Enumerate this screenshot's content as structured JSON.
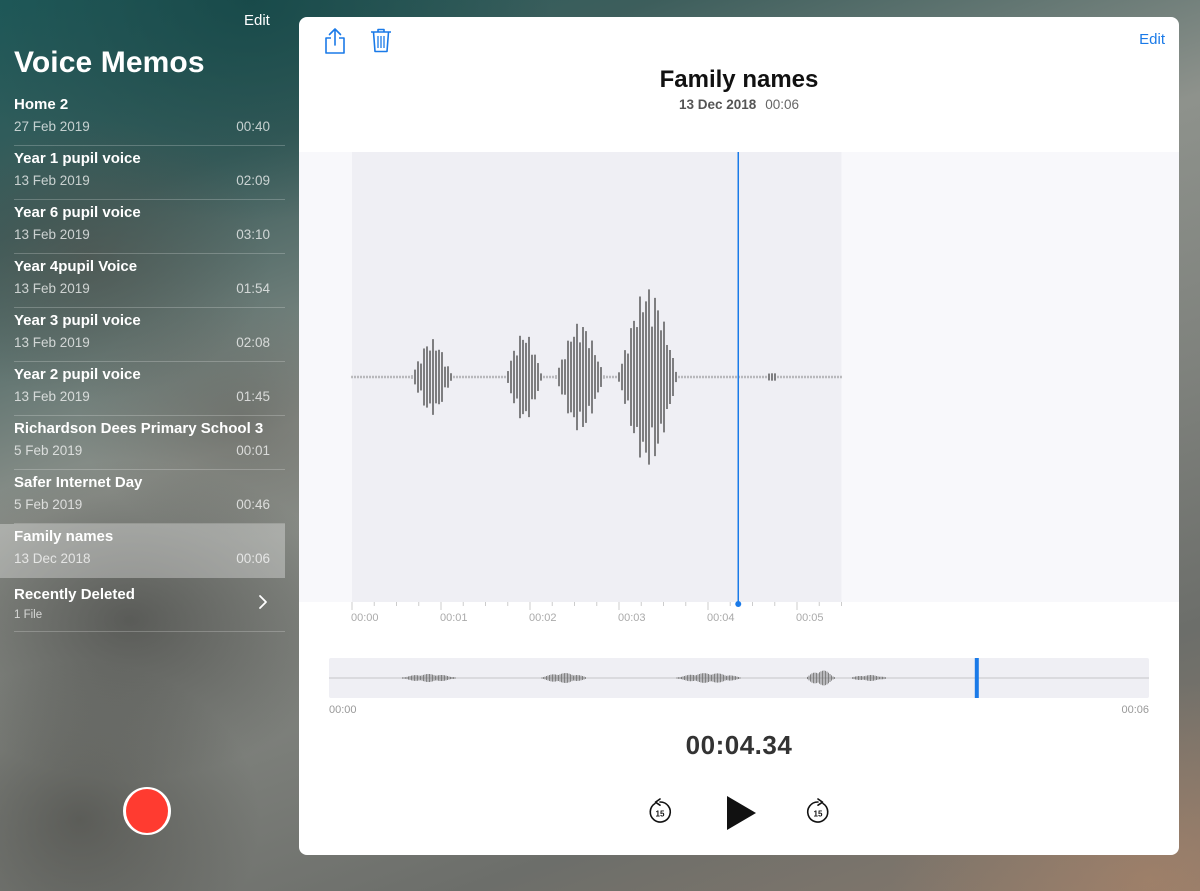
{
  "sidebar": {
    "edit_label": "Edit",
    "title": "Voice Memos",
    "memos": [
      {
        "name": "Home 2",
        "date": "27 Feb 2019",
        "duration": "00:40",
        "selected": false
      },
      {
        "name": "Year 1 pupil voice",
        "date": "13 Feb 2019",
        "duration": "02:09",
        "selected": false
      },
      {
        "name": "Year 6 pupil voice",
        "date": "13 Feb 2019",
        "duration": "03:10",
        "selected": false
      },
      {
        "name": "Year 4pupil Voice",
        "date": "13 Feb 2019",
        "duration": "01:54",
        "selected": false
      },
      {
        "name": "Year 3 pupil voice",
        "date": "13 Feb 2019",
        "duration": "02:08",
        "selected": false
      },
      {
        "name": "Year 2 pupil voice",
        "date": "13 Feb 2019",
        "duration": "01:45",
        "selected": false
      },
      {
        "name": "Richardson Dees Primary School 3",
        "date": "5 Feb 2019",
        "duration": "00:01",
        "selected": false
      },
      {
        "name": "Safer Internet Day",
        "date": "5 Feb 2019",
        "duration": "00:46",
        "selected": false
      },
      {
        "name": "Family names",
        "date": "13 Dec 2018",
        "duration": "00:06",
        "selected": true
      }
    ],
    "recently_deleted": {
      "label": "Recently Deleted",
      "count": "1 File",
      "icon": "chevron-right-icon"
    },
    "record_button": {
      "icon": "record-icon",
      "color": "#ff3b30"
    }
  },
  "detail": {
    "toolbar": {
      "share_icon": "share-icon",
      "trash_icon": "trash-icon",
      "edit_label": "Edit"
    },
    "title": "Family names",
    "date": "13 Dec 2018",
    "duration": "00:06",
    "accent_color": "#1a7ae8",
    "timeline": {
      "ticks": [
        "00:00",
        "00:01",
        "00:02",
        "00:03",
        "00:04",
        "00:05"
      ],
      "playhead_seconds": 4.34
    },
    "scrubber": {
      "start": "00:00",
      "end": "00:06",
      "position_fraction": 0.79
    },
    "current_time": "00:04.34",
    "controls": {
      "back_icon": "skip-back-15-icon",
      "play_icon": "play-icon",
      "forward_icon": "skip-forward-15-icon",
      "skip_seconds": "15"
    }
  }
}
